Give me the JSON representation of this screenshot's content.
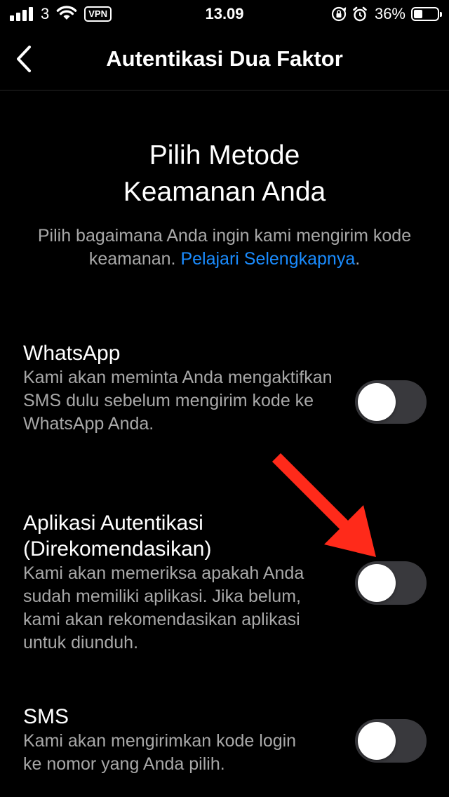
{
  "status_bar": {
    "carrier": "3",
    "vpn": "VPN",
    "time": "13.09",
    "battery_percent": "36%",
    "battery_level": 0.36,
    "icons": [
      "signal-icon",
      "wifi-icon",
      "orientation-lock-icon",
      "alarm-icon",
      "battery-icon"
    ]
  },
  "nav": {
    "title": "Autentikasi Dua Faktor",
    "back_icon": "chevron-left-icon"
  },
  "heading": {
    "line1": "Pilih Metode",
    "line2": "Keamanan Anda"
  },
  "subtitle": {
    "text": "Pilih bagaimana Anda ingin kami mengirim kode keamanan. ",
    "link": "Pelajari Selengkapnya",
    "after": "."
  },
  "options": [
    {
      "title": "WhatsApp",
      "description": "Kami akan meminta Anda mengaktifkan SMS dulu sebelum mengirim kode ke WhatsApp Anda.",
      "enabled": false
    },
    {
      "title": "Aplikasi Autentikasi (Direkomendasikan)",
      "description": "Kami akan memeriksa apakah Anda sudah memiliki aplikasi. Jika belum, kami akan rekomendasikan aplikasi untuk diunduh.",
      "enabled": false
    },
    {
      "title": "SMS",
      "description": "Kami akan mengirimkan kode login ke nomor yang Anda pilih.",
      "enabled": false
    }
  ],
  "colors": {
    "background": "#000000",
    "text": "#ffffff",
    "secondary_text": "#a8a8a8",
    "link": "#1a8cff",
    "toggle_off": "#39393d",
    "annotation_arrow": "#ff2a1a"
  }
}
